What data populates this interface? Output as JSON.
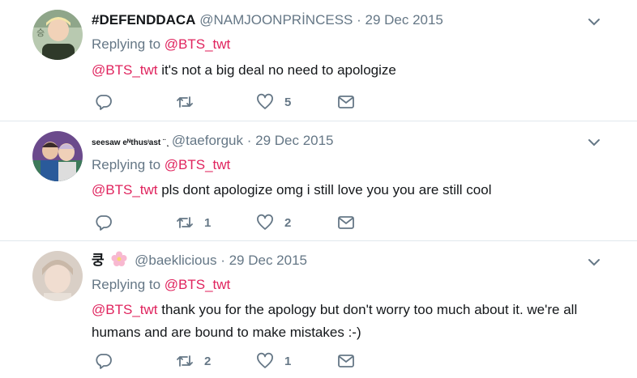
{
  "tweets": [
    {
      "name": "#DEFENDDACA",
      "handle": "@NAMJOONPRİNCESS",
      "dot": " · ",
      "date": "29 Dec 2015",
      "replying_prefix": "Replying to ",
      "replying_to": "@BTS_twt",
      "mention": "@BTS_twt",
      "body": " it's not a big deal no need to apologize",
      "reply_count": "",
      "retweet_count": "",
      "like_count": "5"
    },
    {
      "name": "seesaw eᴺthusᶦast ¨ ̨",
      "handle": "@taeforguk",
      "dot": " · ",
      "date": "29 Dec 2015",
      "replying_prefix": "Replying to ",
      "replying_to": "@BTS_twt",
      "mention": "@BTS_twt",
      "body": " pls dont apologize omg i still love you you are still cool",
      "reply_count": "",
      "retweet_count": "1",
      "like_count": "2"
    },
    {
      "name": "쿵",
      "handle": "@baeklicious",
      "dot": " · ",
      "date": "29 Dec 2015",
      "replying_prefix": "Replying to ",
      "replying_to": "@BTS_twt",
      "mention": "@BTS_twt",
      "body": " thank you for the apology but don't worry too much about it. we're all humans and are bound to make mistakes :-)",
      "reply_count": "",
      "retweet_count": "2",
      "like_count": "1"
    }
  ],
  "colors": {
    "mention": "#e0245e",
    "muted": "#657786",
    "text": "#14171a",
    "divider": "#e1e8ed"
  },
  "icons": [
    "reply-icon",
    "retweet-icon",
    "like-icon",
    "message-icon",
    "caret-down-icon",
    "flower-emoji-icon"
  ]
}
